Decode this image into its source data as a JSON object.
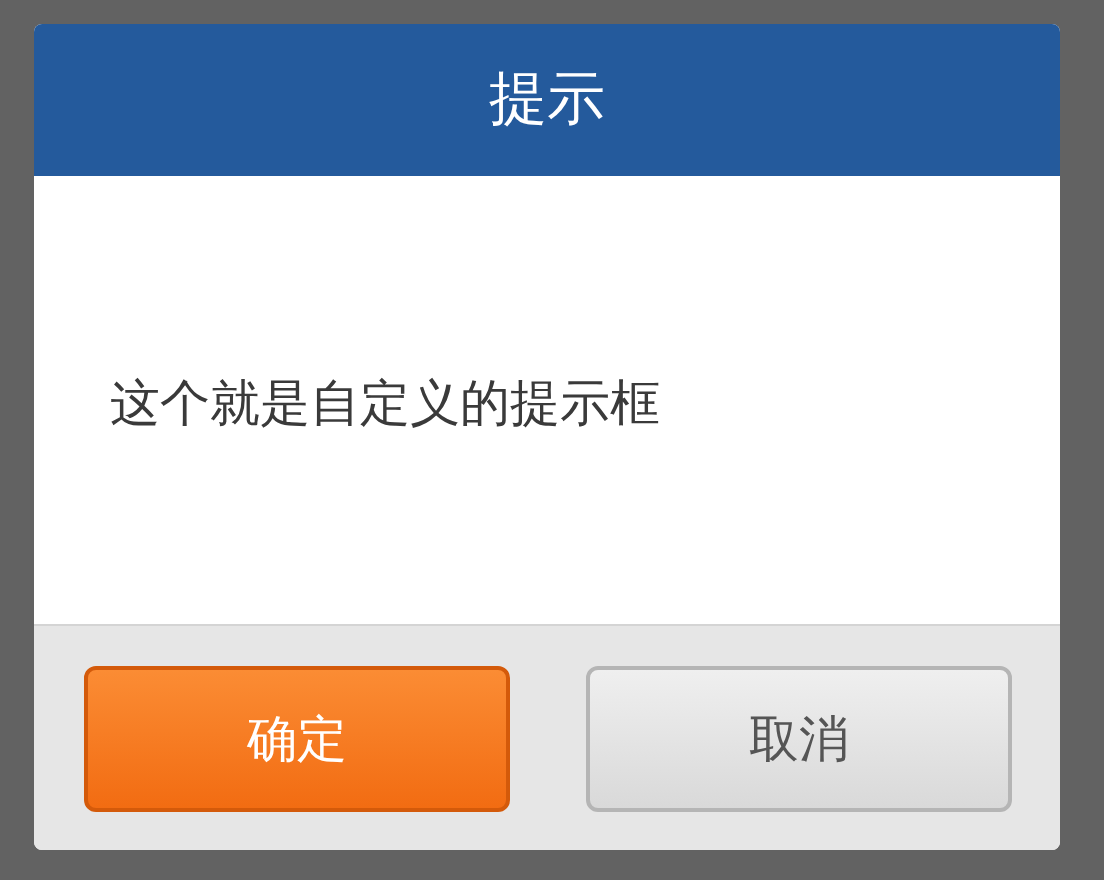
{
  "dialog": {
    "title": "提示",
    "message": "这个就是自定义的提示框",
    "buttons": [
      {
        "label": "确定",
        "kind": "primary"
      },
      {
        "label": "取消",
        "kind": "secondary"
      }
    ]
  }
}
